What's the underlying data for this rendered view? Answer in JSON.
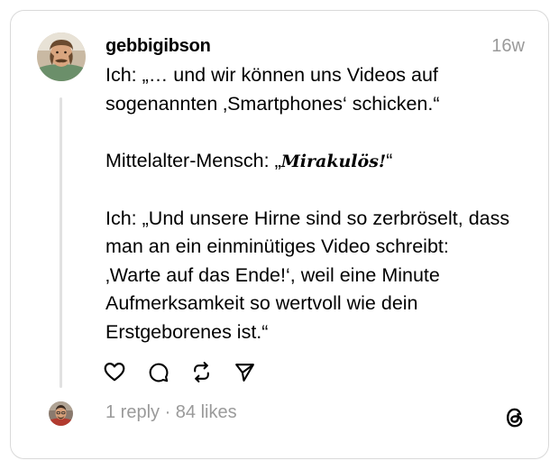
{
  "post": {
    "username": "gebbigibson",
    "timestamp": "16w",
    "lines": {
      "l1": "Ich: „… und wir können uns Videos auf",
      "l2": "sogenannten ‚Smartphones‘ schicken.“",
      "l3_prefix": "Mittelalter-Mensch: „",
      "l3_word": "Mirakulös!",
      "l3_suffix": "“",
      "l4": "Ich: „Und unsere Hirne sind so zerbröselt, dass",
      "l5": "man an ein einminütiges Video schreibt:",
      "l6": "‚Warte auf das Ende!‘, weil eine Minute",
      "l7": "Aufmerksamkeit so wertvoll wie dein",
      "l8": "Erstgeborenes ist.“"
    }
  },
  "actions": {
    "like_icon": "heart-icon",
    "reply_icon": "comment-icon",
    "repost_icon": "repost-icon",
    "share_icon": "send-icon"
  },
  "stats": {
    "text": "1 reply · 84 likes"
  },
  "branding": {
    "logo_icon": "threads-logo-icon"
  },
  "colors": {
    "text": "#000000",
    "muted": "#9a9a9a",
    "border": "#d9d9d9",
    "thread_line": "#e1e1e1"
  }
}
